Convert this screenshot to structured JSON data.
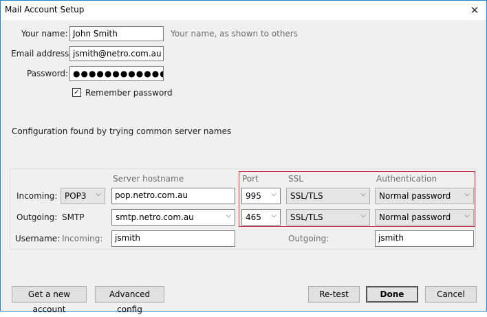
{
  "window": {
    "title": "Mail Account Setup"
  },
  "form": {
    "name_label": "Your name:",
    "name_value": "John Smith",
    "name_hint": "Your name, as shown to others",
    "email_label": "Email address:",
    "email_value": "jsmith@netro.com.au",
    "password_label": "Password:",
    "password_masked": "●●●●●●●●●●●●●●●●●",
    "remember_label": "Remember password",
    "remember_checked": "✓"
  },
  "status_text": "Configuration found by trying common server names",
  "server": {
    "headers": {
      "hostname": "Server hostname",
      "port": "Port",
      "ssl": "SSL",
      "auth": "Authentication"
    },
    "incoming": {
      "label": "Incoming:",
      "protocol": "POP3",
      "hostname": "pop.netro.com.au",
      "port": "995",
      "ssl": "SSL/TLS",
      "auth": "Normal password"
    },
    "outgoing": {
      "label": "Outgoing:",
      "protocol": "SMTP",
      "hostname": "smtp.netro.com.au",
      "port": "465",
      "ssl": "SSL/TLS",
      "auth": "Normal password"
    },
    "username": {
      "label": "Username:",
      "incoming_label": "Incoming:",
      "incoming_value": "jsmith",
      "outgoing_label": "Outgoing:",
      "outgoing_value": "jsmith"
    }
  },
  "buttons": {
    "new_account": "Get a new account",
    "advanced": "Advanced config",
    "retest": "Re-test",
    "done": "Done",
    "cancel": "Cancel"
  },
  "icons": {
    "close": "close-icon",
    "dropdown": "chevron-down-icon",
    "check": "checkmark-icon"
  },
  "colors": {
    "highlight": "#c0262d",
    "window_border": "#1883d7"
  }
}
